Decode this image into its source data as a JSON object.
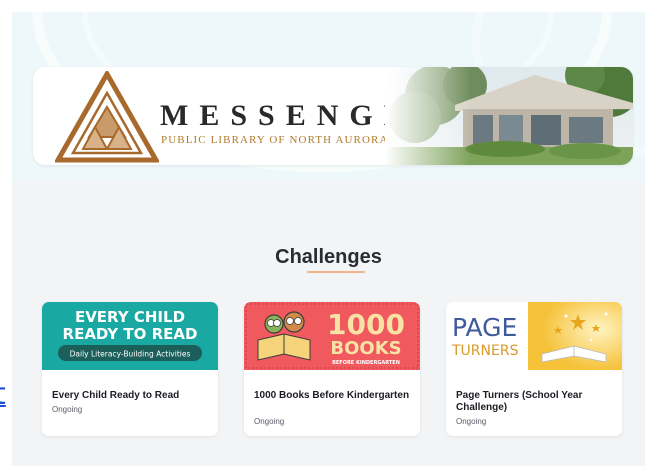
{
  "header": {
    "brand_name": "MESSENGER",
    "brand_subtitle": "PUBLIC LIBRARY OF NORTH AURORA"
  },
  "stray_link_text": "t",
  "challenges_section": {
    "title": "Challenges",
    "cards": [
      {
        "image_line1": "EVERY CHILD",
        "image_line2": "READY TO READ",
        "image_tagline": "Daily Literacy-Building Activities",
        "title": "Every Child Ready to Read",
        "status": "Ongoing",
        "image_color": "#1aa8a2"
      },
      {
        "image_big": "1000",
        "image_word": "BOOKS",
        "image_sub": "BEFORE KINDERGARTEN",
        "title": "1000 Books Before Kindergarten",
        "status": "Ongoing",
        "image_color": "#f0595e"
      },
      {
        "image_line1": "PAGE",
        "image_line2": "TURNERS",
        "title": "Page Turners (School Year Challenge)",
        "status": "Ongoing",
        "image_color": "#f5c23a"
      }
    ]
  },
  "colors": {
    "brand_brown": "#a86a2c",
    "brand_gold": "#b07a2a",
    "underline_accent": "#f2b48a",
    "link_blue": "#1a4fd6"
  }
}
